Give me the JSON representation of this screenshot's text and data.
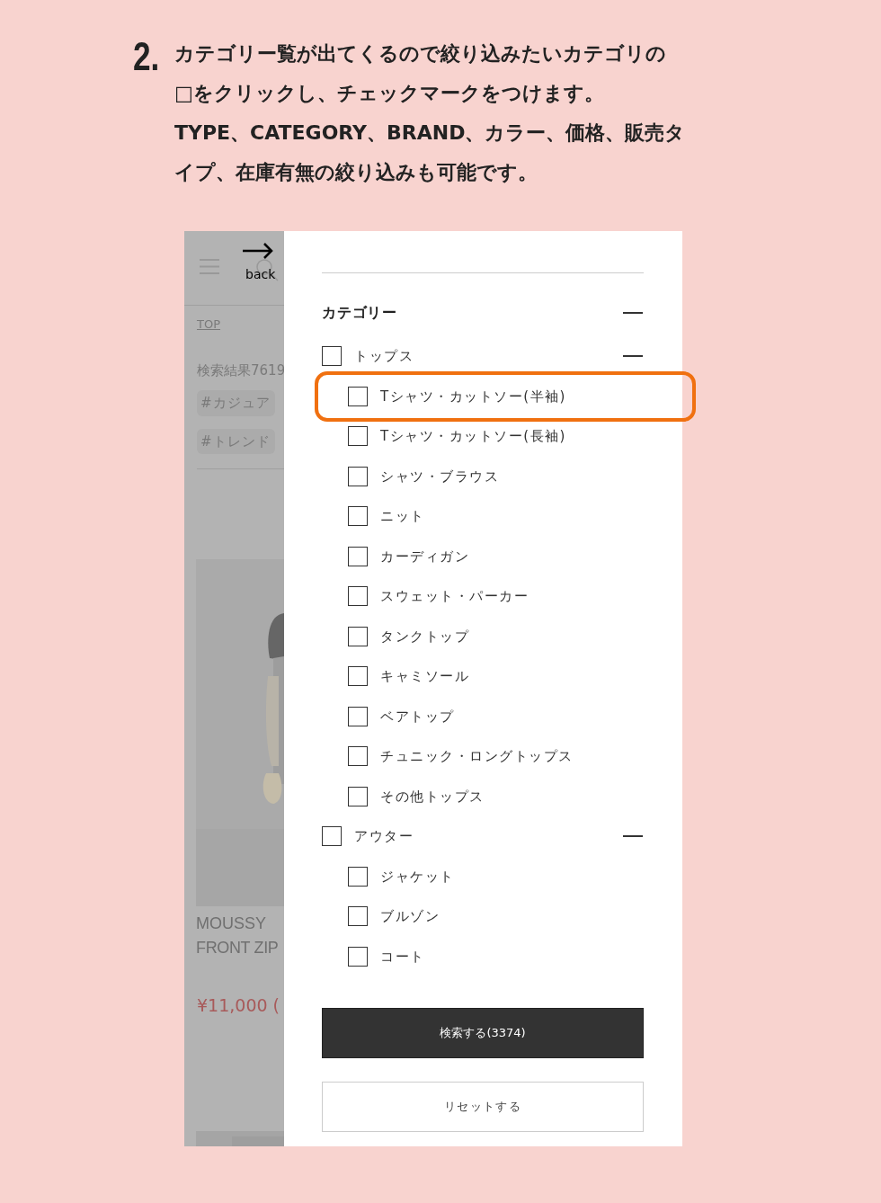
{
  "instruction": {
    "step": "2.",
    "lines": [
      "カテゴリー覧が出てくるので絞り込みたいカテゴリの",
      "□をクリックし、チェックマークをつけます。",
      "TYPE、CATEGORY、BRAND、カラー、価格、販売タ",
      "イプ、在庫有無の絞り込みも可能です。"
    ]
  },
  "background_page": {
    "back_label": "back",
    "breadcrumb": "TOP",
    "result_text": "検索結果7619",
    "tags": [
      "#カジュア",
      "#トレンド"
    ],
    "product": {
      "kind": "picture",
      "brand": "MOUSSY",
      "name": "FRONT ZIP",
      "price": "¥11,000 ("
    }
  },
  "filter_panel": {
    "section": {
      "title": "カテゴリー",
      "expanded": true
    },
    "groups": [
      {
        "label": "トップス",
        "checked": false,
        "expanded": true,
        "children": [
          {
            "label": "Tシャツ・カットソー(半袖)",
            "checked": false,
            "highlighted": true
          },
          {
            "label": "Tシャツ・カットソー(長袖)",
            "checked": false,
            "highlighted": false
          },
          {
            "label": "シャツ・ブラウス",
            "checked": false,
            "highlighted": false
          },
          {
            "label": "ニット",
            "checked": false,
            "highlighted": false
          },
          {
            "label": "カーディガン",
            "checked": false,
            "highlighted": false
          },
          {
            "label": "スウェット・パーカー",
            "checked": false,
            "highlighted": false
          },
          {
            "label": "タンクトップ",
            "checked": false,
            "highlighted": false
          },
          {
            "label": "キャミソール",
            "checked": false,
            "highlighted": false
          },
          {
            "label": "ベアトップ",
            "checked": false,
            "highlighted": false
          },
          {
            "label": "チュニック・ロングトップス",
            "checked": false,
            "highlighted": false
          },
          {
            "label": "その他トップス",
            "checked": false,
            "highlighted": false
          }
        ]
      },
      {
        "label": "アウター",
        "checked": false,
        "expanded": true,
        "children": [
          {
            "label": "ジャケット",
            "checked": false,
            "highlighted": false
          },
          {
            "label": "ブルゾン",
            "checked": false,
            "highlighted": false
          },
          {
            "label": "コート",
            "checked": false,
            "highlighted": false
          }
        ]
      }
    ],
    "search_button": "検索する(3374)",
    "reset_button": "リセットする"
  }
}
